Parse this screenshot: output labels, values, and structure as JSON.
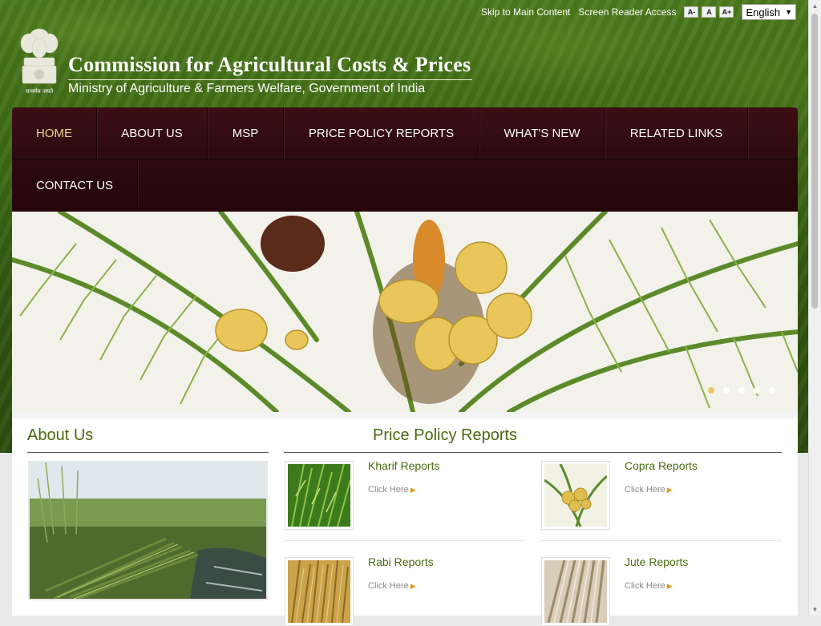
{
  "utility": {
    "skip_link": "Skip to Main Content",
    "screen_reader": "Screen Reader Access",
    "font_smaller": "A-",
    "font_normal": "A",
    "font_larger": "A+",
    "language": "English"
  },
  "header": {
    "title": "Commission for Agricultural Costs & Prices",
    "subtitle": "Ministry of Agriculture & Farmers Welfare, Government of India",
    "emblem_caption": "सत्यमेव जयते"
  },
  "nav": {
    "items": [
      {
        "label": "HOME"
      },
      {
        "label": "ABOUT US"
      },
      {
        "label": "MSP"
      },
      {
        "label": "PRICE POLICY REPORTS"
      },
      {
        "label": "WHAT'S NEW"
      },
      {
        "label": "RELATED LINKS"
      },
      {
        "label": "CONTACT US"
      }
    ]
  },
  "slider": {
    "slides": 5,
    "active_slide": 1
  },
  "about": {
    "heading": "About Us"
  },
  "reports": {
    "heading": "Price Policy Reports",
    "items": [
      {
        "title": "Kharif Reports",
        "link": "Click Here"
      },
      {
        "title": "Copra Reports",
        "link": "Click Here"
      },
      {
        "title": "Rabi Reports",
        "link": "Click Here"
      },
      {
        "title": "Jute Reports",
        "link": "Click Here"
      }
    ]
  },
  "colors": {
    "nav_bg": "#2d0a0f",
    "nav_active": "#f0d28a",
    "heading_green": "#4a6a10",
    "link_arrow": "#e39a1d"
  }
}
